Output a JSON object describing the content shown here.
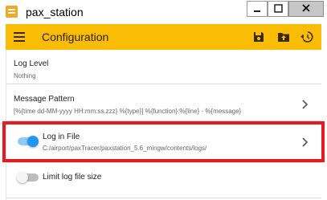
{
  "window": {
    "title": "pax_station",
    "app_icon": "app-document-icon",
    "controls": [
      "minimize-icon",
      "maximize-icon",
      "close-icon"
    ]
  },
  "appbar": {
    "title": "Configuration",
    "background": "#fbbc05",
    "menu_icon": "menu-icon",
    "actions": [
      "save-icon",
      "upload-folder-icon",
      "restore-history-icon"
    ]
  },
  "settings": {
    "log_level": {
      "label": "Log Level",
      "value": "Nothing"
    },
    "message_pattern": {
      "label": "Message Pattern",
      "value": "[%{time dd-MM-yyyy HH:mm:ss.zzz} %{type}] %{function}:%{line} - %{message}"
    },
    "log_in_file": {
      "label": "Log in File",
      "value": "C:/airport/paxTracer/paxstation_5.6_mingw/contents/logs/",
      "enabled": true,
      "toggle_color": "#2196f3"
    },
    "limit_log_file_size": {
      "label": "Limit log file size",
      "enabled": false
    }
  },
  "annotation": {
    "color": "#e31b23"
  }
}
